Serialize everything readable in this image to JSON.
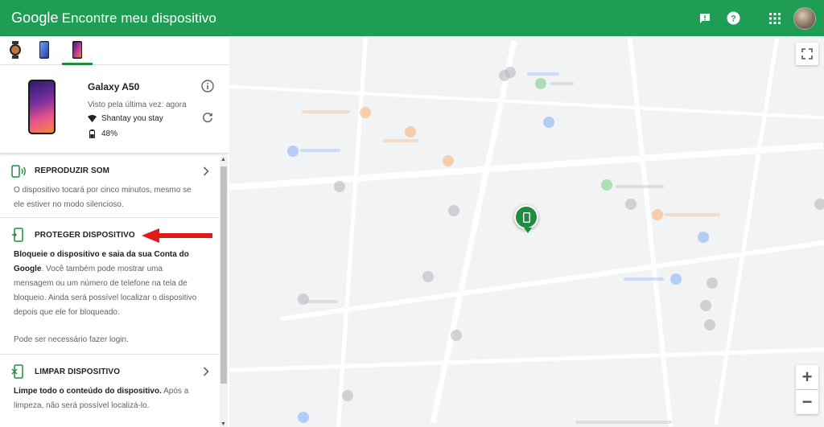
{
  "header": {
    "brand_google": "Google",
    "brand_title": "Encontre meu dispositivo",
    "bg_color": "#1f9d55"
  },
  "header_icons": [
    "feedback-icon",
    "help-icon",
    "apps-icon",
    "avatar"
  ],
  "devices": [
    {
      "icon": "watch-icon",
      "active": false
    },
    {
      "icon": "phone-icon",
      "active": false
    },
    {
      "icon": "phone-icon",
      "active": true
    }
  ],
  "device": {
    "name": "Galaxy A50",
    "last_seen": "Visto pela última vez: agora",
    "wifi": "Shantay you stay",
    "battery": "48%"
  },
  "actions": {
    "play_sound": {
      "title": "REPRODUZIR SOM",
      "desc": "O dispositivo tocará por cinco minutos, mesmo se ele estiver no modo silencioso."
    },
    "secure": {
      "title": "PROTEGER DISPOSITIVO",
      "desc_bold_1": "Bloqueie o dispositivo e saia da sua Conta do Google",
      "desc_1": ". Você também pode mostrar uma mensagem ou um número de telefone na tela de bloqueio. Ainda será possível localizar o dispositivo depois que ele for bloqueado.",
      "desc_2": "Pode ser necessário fazer login."
    },
    "erase": {
      "title": "LIMPAR DISPOSITIVO",
      "desc_bold_1": "Limpe todo o conteúdo do dispositivo.",
      "desc_1": " Após a limpeza, não será possível localizá-lo."
    }
  },
  "map": {
    "zoom_in": "+",
    "zoom_out": "−",
    "accent": "#1e8e3e"
  }
}
